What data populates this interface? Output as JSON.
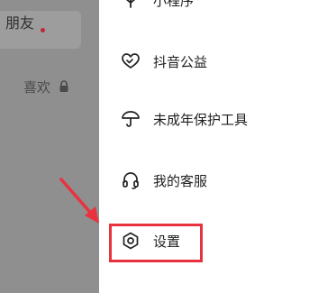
{
  "background": {
    "friend_tab_label": "朋友",
    "likes_label": "喜欢"
  },
  "drawer": {
    "items": [
      {
        "label": "小程序",
        "icon": "mini-program-icon"
      },
      {
        "label": "抖音公益",
        "icon": "heart-hands-icon"
      },
      {
        "label": "未成年保护工具",
        "icon": "umbrella-icon"
      },
      {
        "label": "我的客服",
        "icon": "headset-icon"
      },
      {
        "label": "设置",
        "icon": "gear-hexagon-icon"
      }
    ]
  },
  "annotation": {
    "highlight_color": "#e8333f",
    "arrow_color": "#e8333f",
    "highlighted_item": "设置"
  },
  "colors": {
    "overlay": "#8f8f8f",
    "drawer_bg": "#ffffff",
    "badge_dot": "#c0273a"
  }
}
